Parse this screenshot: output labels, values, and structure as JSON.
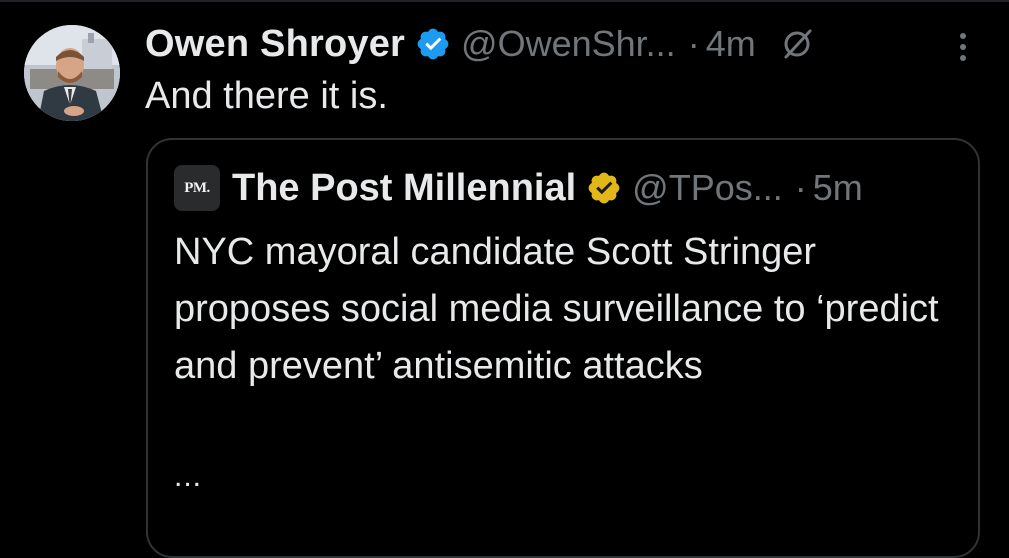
{
  "tweet": {
    "display_name": "Owen Shroyer",
    "handle": "@OwenShr...",
    "separator": "·",
    "time": "4m",
    "text": "And there it is.",
    "verified_icon": "blue-verified-badge",
    "grok_icon": "grok-icon",
    "more_icon": "more-vertical-icon"
  },
  "quote": {
    "avatar_text": "PM.",
    "display_name": "The Post Millennial",
    "handle": "@TPos...",
    "separator": "·",
    "time": "5m",
    "text": "NYC mayoral candidate Scott Stringer proposes social media surveillance to ‘predict and prevent’ antisemitic attacks",
    "ellipsis": "...",
    "verified_icon": "gold-verified-badge"
  },
  "colors": {
    "background": "#000000",
    "text_primary": "#e7e9ea",
    "text_secondary": "#71767b",
    "verified_blue": "#1d9bf0",
    "verified_gold": "#e2b719",
    "card_border": "#2f3336"
  }
}
